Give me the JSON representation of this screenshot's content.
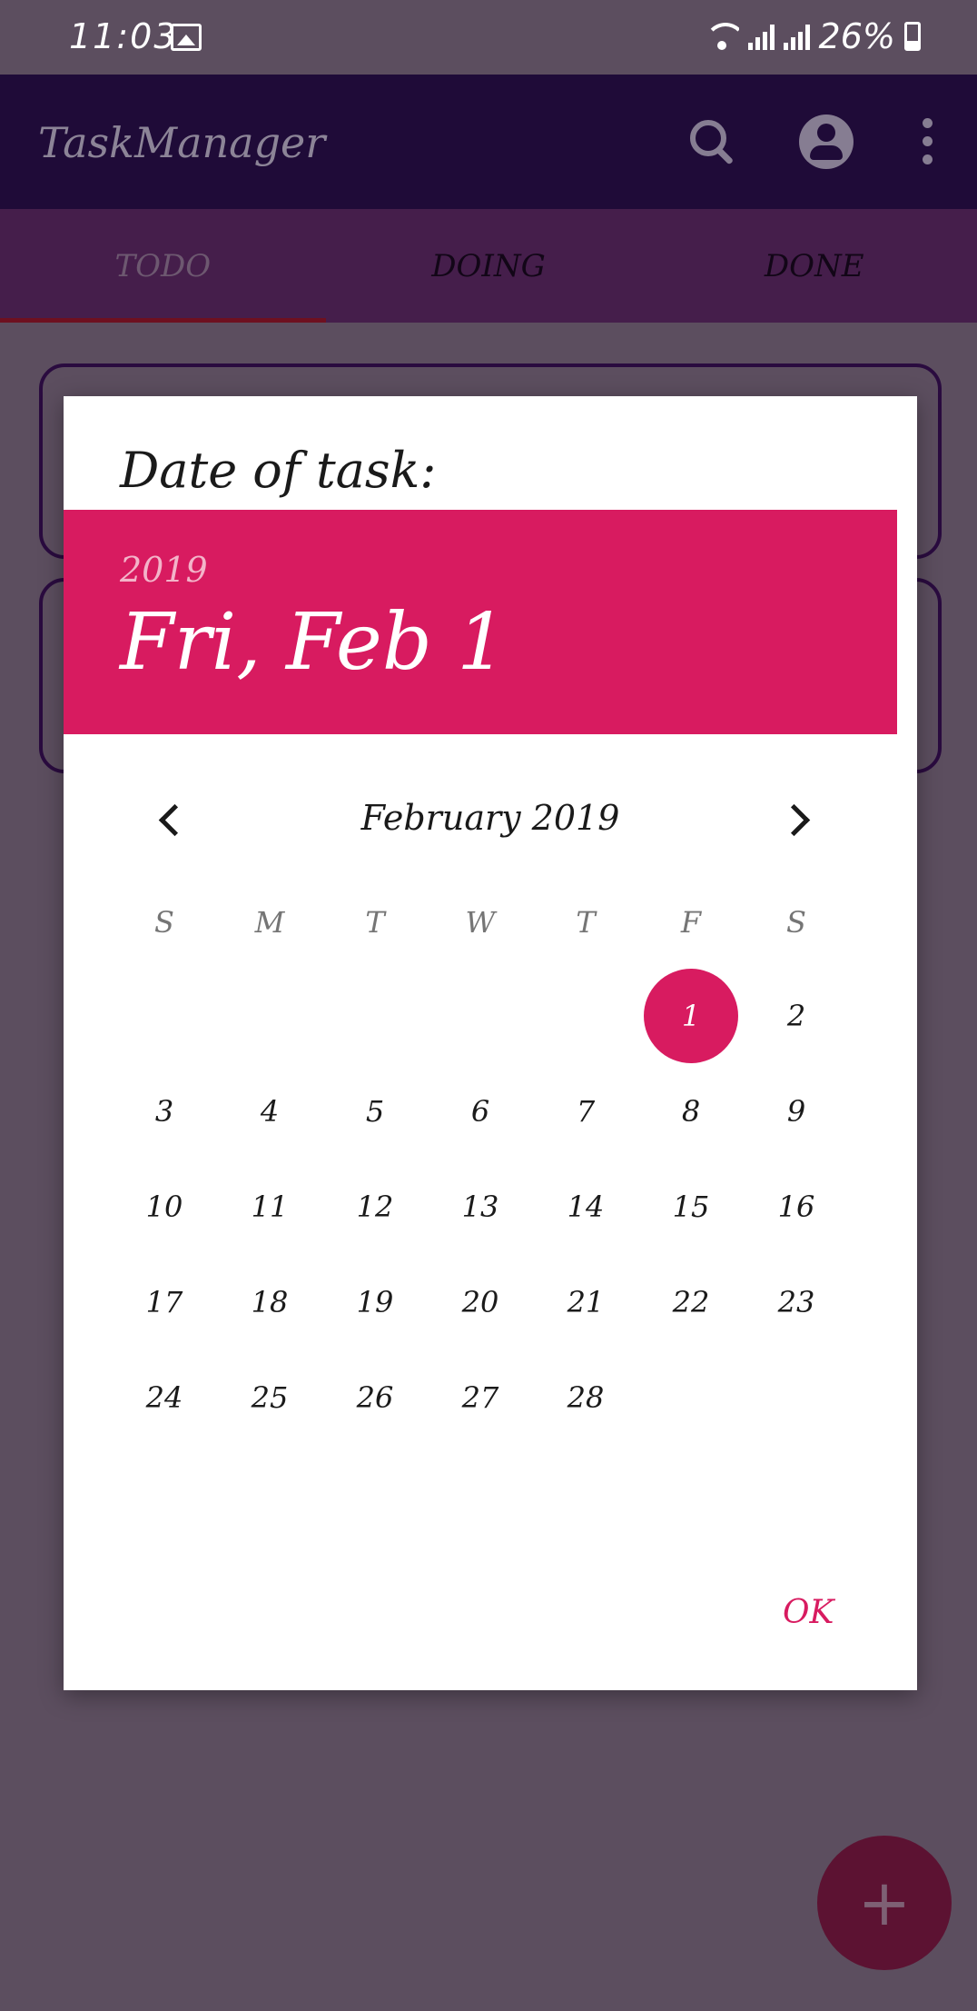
{
  "status_bar": {
    "time": "11:03",
    "battery": "26%"
  },
  "app_bar": {
    "title": "TaskManager"
  },
  "tabs": [
    {
      "label": "TODO",
      "active": true
    },
    {
      "label": "DOING",
      "active": false
    },
    {
      "label": "DONE",
      "active": false
    }
  ],
  "dialog": {
    "title": "Date of task:",
    "year": "2019",
    "selected_date": "Fri, Feb 1",
    "month_label": "February 2019",
    "weekdays": [
      "S",
      "M",
      "T",
      "W",
      "T",
      "F",
      "S"
    ],
    "first_weekday_index": 5,
    "days": [
      "1",
      "2",
      "3",
      "4",
      "5",
      "6",
      "7",
      "8",
      "9",
      "10",
      "11",
      "12",
      "13",
      "14",
      "15",
      "16",
      "17",
      "18",
      "19",
      "20",
      "21",
      "22",
      "23",
      "24",
      "25",
      "26",
      "27",
      "28"
    ],
    "selected_day": "1",
    "ok_label": "OK"
  },
  "fab": {
    "label": "+"
  },
  "colors": {
    "accent": "#d81b60",
    "app_bar": "#1f0b38",
    "tab_bar": "#451e4b",
    "scrim_background": "#5c4e5f"
  }
}
